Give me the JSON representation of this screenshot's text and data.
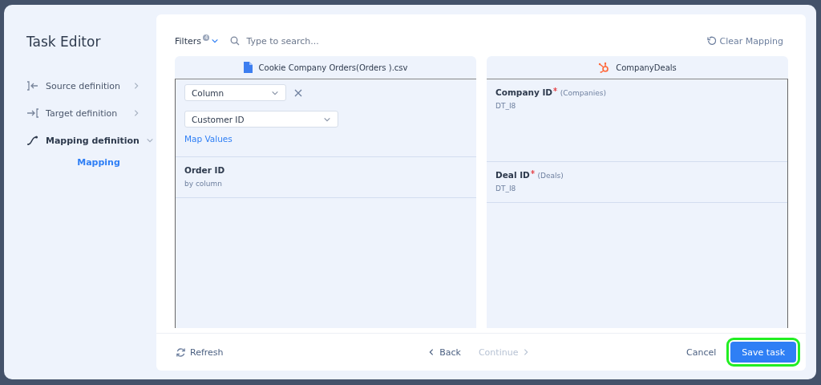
{
  "dialog": {
    "title": "Task Editor"
  },
  "sidebar": {
    "items": [
      {
        "label": "Source definition",
        "kind": "source",
        "selected": false,
        "expanded": false
      },
      {
        "label": "Target definition",
        "kind": "target",
        "selected": false,
        "expanded": false
      },
      {
        "label": "Mapping definition",
        "kind": "mapping",
        "selected": true,
        "expanded": true,
        "children": [
          {
            "label": "Mapping",
            "selected": true
          }
        ]
      }
    ]
  },
  "toolbar": {
    "filters_label": "Filters",
    "filters_count": "4",
    "search_placeholder": "Type to search...",
    "clear_label": "Clear Mapping"
  },
  "source": {
    "title": "Cookie Company Orders(Orders ).csv",
    "rows": [
      {
        "kind": "editor",
        "type_value": "Column",
        "field_value": "Customer ID",
        "link": "Map Values"
      },
      {
        "kind": "plain",
        "name": "Order ID",
        "detail": "by column"
      }
    ]
  },
  "target": {
    "title": "CompanyDeals",
    "rows": [
      {
        "name": "Company ID",
        "required": true,
        "object": "(Companies)",
        "type": "DT_I8"
      },
      {
        "name": "Deal ID",
        "required": true,
        "object": "(Deals)",
        "type": "DT_I8"
      }
    ]
  },
  "footer": {
    "refresh": "Refresh",
    "back": "Back",
    "continue": {
      "label": "Continue",
      "disabled": true
    },
    "cancel": "Cancel",
    "save": {
      "label": "Save task",
      "highlighted": true
    }
  }
}
